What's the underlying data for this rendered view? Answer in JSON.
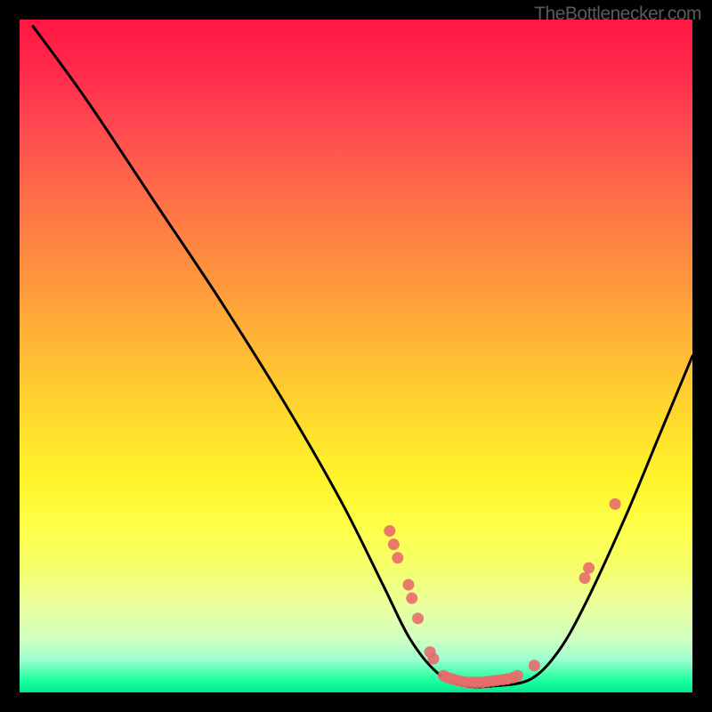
{
  "watermark": "TheBottlenecker.com",
  "chart_data": {
    "type": "line",
    "title": "",
    "xlabel": "",
    "ylabel": "",
    "xlim": [
      0,
      100
    ],
    "ylim": [
      0,
      100
    ],
    "curve": [
      {
        "x": 2,
        "y": 99
      },
      {
        "x": 10,
        "y": 88
      },
      {
        "x": 20,
        "y": 73
      },
      {
        "x": 30,
        "y": 58
      },
      {
        "x": 40,
        "y": 42
      },
      {
        "x": 48,
        "y": 28
      },
      {
        "x": 54,
        "y": 16
      },
      {
        "x": 58,
        "y": 8
      },
      {
        "x": 62,
        "y": 3
      },
      {
        "x": 66,
        "y": 1
      },
      {
        "x": 71,
        "y": 1
      },
      {
        "x": 76,
        "y": 2
      },
      {
        "x": 80,
        "y": 6
      },
      {
        "x": 84,
        "y": 13
      },
      {
        "x": 90,
        "y": 26
      },
      {
        "x": 95,
        "y": 38
      },
      {
        "x": 100,
        "y": 50
      }
    ],
    "points": [
      {
        "x": 55,
        "y": 24
      },
      {
        "x": 55.6,
        "y": 22
      },
      {
        "x": 56.2,
        "y": 20
      },
      {
        "x": 57.8,
        "y": 16
      },
      {
        "x": 58.3,
        "y": 14
      },
      {
        "x": 59.2,
        "y": 11
      },
      {
        "x": 61.0,
        "y": 6
      },
      {
        "x": 61.5,
        "y": 5
      },
      {
        "x": 63.0,
        "y": 2.5
      },
      {
        "x": 63.6,
        "y": 2.2
      },
      {
        "x": 64.3,
        "y": 2.0
      },
      {
        "x": 65.0,
        "y": 1.8
      },
      {
        "x": 65.8,
        "y": 1.6
      },
      {
        "x": 66.5,
        "y": 1.5
      },
      {
        "x": 67.3,
        "y": 1.5
      },
      {
        "x": 68.0,
        "y": 1.5
      },
      {
        "x": 68.8,
        "y": 1.5
      },
      {
        "x": 69.5,
        "y": 1.6
      },
      {
        "x": 70.3,
        "y": 1.7
      },
      {
        "x": 71.0,
        "y": 1.8
      },
      {
        "x": 71.8,
        "y": 1.9
      },
      {
        "x": 72.5,
        "y": 2.0
      },
      {
        "x": 73.3,
        "y": 2.2
      },
      {
        "x": 74.0,
        "y": 2.5
      },
      {
        "x": 76.5,
        "y": 4.0
      },
      {
        "x": 84.0,
        "y": 17
      },
      {
        "x": 84.6,
        "y": 18.5
      },
      {
        "x": 88.5,
        "y": 28
      }
    ]
  }
}
